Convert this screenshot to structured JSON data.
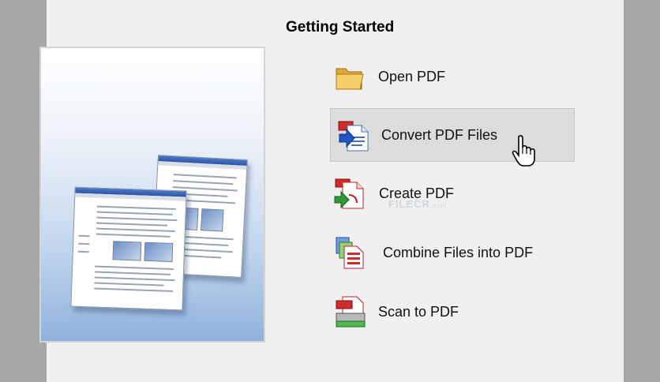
{
  "heading": "Getting Started",
  "actions": [
    {
      "label": "Open PDF",
      "icon": "folder-icon"
    },
    {
      "label": "Convert PDF Files",
      "icon": "convert-pdf-icon",
      "highlighted": true
    },
    {
      "label": "Create PDF",
      "icon": "create-pdf-icon"
    },
    {
      "label": "Combine Files into PDF",
      "icon": "combine-files-icon"
    },
    {
      "label": "Scan to PDF",
      "icon": "scan-pdf-icon"
    }
  ],
  "watermark": {
    "text": "FILECR",
    "suffix": ".com"
  },
  "colors": {
    "highlight": "#dcdcdc",
    "panel": "#f0f0f0",
    "backdrop": "#a6a6a6"
  }
}
